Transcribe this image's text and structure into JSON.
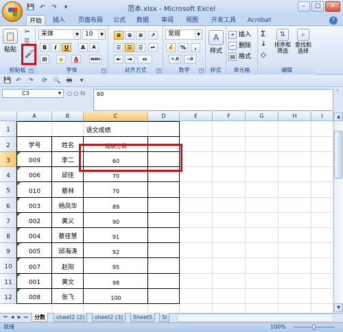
{
  "window": {
    "title": "范本.xlsx - Microsoft Excel",
    "min": "–",
    "max": "□",
    "close": "✕"
  },
  "qat": [
    "💾",
    "↶",
    "↷",
    "▾"
  ],
  "tabs": [
    "开始",
    "插入",
    "页面布局",
    "公式",
    "数据",
    "审阅",
    "视图",
    "开发工具",
    "Acrobat"
  ],
  "ribbon": {
    "clipboard": {
      "label": "剪贴板",
      "paste": "粘贴",
      "cut": "✂",
      "copy": "⎘"
    },
    "font": {
      "label": "字体",
      "name": "宋体",
      "size": "10",
      "bold": "B",
      "italic": "I",
      "underline": "U",
      "grow": "A",
      "shrink": "A",
      "border": "⊞",
      "fill": "◆",
      "color": "A",
      "phonetic": "wén"
    },
    "align": {
      "label": "对齐方式"
    },
    "number": {
      "label": "数字",
      "format": "常规",
      "currency": "💰",
      "percent": "%",
      "comma": ",",
      "inc": "+.0",
      "dec": "-.0"
    },
    "style": {
      "label": "样式",
      "button": "样式"
    },
    "cells": {
      "label": "单元格",
      "insert": "插入",
      "delete": "删除",
      "format": "格式"
    },
    "edit": {
      "label": "编辑",
      "sum": "Σ",
      "fill": "↓",
      "clear": "◇",
      "sort": "排序和\n筛选",
      "find": "查找和\n选择"
    }
  },
  "formula_bar": {
    "name_box": "C3",
    "fx": "fx",
    "value": "60"
  },
  "columns": [
    "A",
    "B",
    "C",
    "D",
    "E",
    "F",
    "G",
    "H",
    "I"
  ],
  "rows": [
    "1",
    "2",
    "3",
    "4",
    "5",
    "6",
    "7",
    "8",
    "9",
    "10",
    "11",
    "12"
  ],
  "sheet": {
    "title": "语文成绩",
    "headers": [
      "学号",
      "姓名",
      "成绩分数"
    ],
    "records": [
      [
        "009",
        "李二",
        "60"
      ],
      [
        "006",
        "邱佳",
        "70"
      ],
      [
        "010",
        "蔡林",
        "70"
      ],
      [
        "003",
        "杨凤华",
        "89"
      ],
      [
        "002",
        "黄义",
        "90"
      ],
      [
        "004",
        "蔡佳慧",
        "91"
      ],
      [
        "005",
        "邱海涛",
        "92"
      ],
      [
        "007",
        "赵阳",
        "95"
      ],
      [
        "001",
        "黄文",
        "98"
      ],
      [
        "008",
        "张飞",
        "100"
      ]
    ]
  },
  "sheet_tabs": [
    "分数",
    "sheet2 (2)",
    "sheet2 (3)",
    "Sheet5",
    "Sl"
  ],
  "status": {
    "mode": "就绪",
    "zoom": "100%"
  },
  "colors": {
    "highlight": "#c0171a",
    "selected_header": "#f7c76a"
  }
}
